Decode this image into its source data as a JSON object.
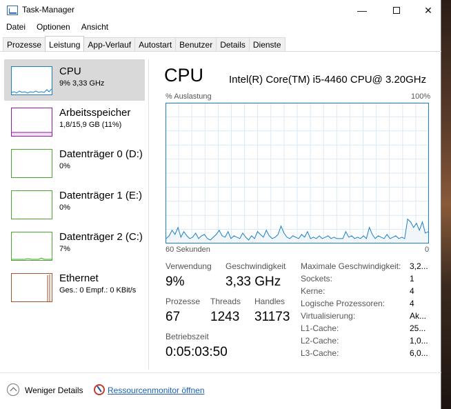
{
  "window": {
    "title": "Task-Manager"
  },
  "menu": [
    "Datei",
    "Optionen",
    "Ansicht"
  ],
  "tabs": [
    "Prozesse",
    "Leistung",
    "App-Verlauf",
    "Autostart",
    "Benutzer",
    "Details",
    "Dienste"
  ],
  "active_tab": "Leistung",
  "sidebar": {
    "items": [
      {
        "name": "CPU",
        "sub": "9%  3,33 GHz",
        "color": "#1a7ec4",
        "selected": true
      },
      {
        "name": "Arbeitsspeicher",
        "sub": "1,8/15,9 GB (11%)",
        "color": "#8b1a9e",
        "selected": false
      },
      {
        "name": "Datenträger 0 (D:)",
        "sub": "0%",
        "color": "#4aa52e",
        "selected": false
      },
      {
        "name": "Datenträger 1 (E:)",
        "sub": "0%",
        "color": "#4aa52e",
        "selected": false
      },
      {
        "name": "Datenträger 2 (C:)",
        "sub": "7%",
        "color": "#4aa52e",
        "selected": false
      },
      {
        "name": "Ethernet",
        "sub": "Ges.: 0 Empf.: 0 KBit/s",
        "color": "#a0522d",
        "selected": false
      }
    ]
  },
  "main": {
    "title": "CPU",
    "model": "Intel(R) Core(TM) i5-4460 CPU@ 3.20GHz",
    "graph": {
      "label_left": "% Auslastung",
      "label_right": "100%",
      "axis_left": "60 Sekunden",
      "axis_right": "0",
      "color": "#1a7ec4",
      "values": [
        3,
        5,
        9,
        6,
        11,
        4,
        8,
        5,
        3,
        4,
        7,
        3,
        5,
        6,
        3,
        2,
        4,
        6,
        9,
        5,
        4,
        8,
        3,
        5,
        4,
        3,
        7,
        4,
        2,
        5,
        3,
        8,
        6,
        4,
        9,
        5,
        3,
        4,
        6,
        12,
        7,
        4,
        3,
        5,
        4,
        3,
        6,
        4,
        8,
        3,
        4,
        3,
        5,
        3,
        4,
        5,
        3,
        4,
        3,
        3,
        3,
        8,
        4,
        5,
        3,
        4,
        3,
        5,
        3,
        11,
        6,
        3,
        5,
        4,
        3,
        6,
        3,
        4,
        5,
        3,
        4,
        3,
        17,
        15,
        11,
        14,
        9,
        15,
        7,
        8
      ]
    },
    "stats": {
      "utilization_label": "Verwendung",
      "utilization": "9%",
      "speed_label": "Geschwindigkeit",
      "speed": "3,33 GHz",
      "processes_label": "Prozesse",
      "processes": "67",
      "threads_label": "Threads",
      "threads": "1243",
      "handles_label": "Handles",
      "handles": "31173",
      "uptime_label": "Betriebszeit",
      "uptime": "0:05:03:50"
    },
    "details": [
      {
        "label": "Maximale Geschwindigkeit:",
        "value": "3,2..."
      },
      {
        "label": "Sockets:",
        "value": "1"
      },
      {
        "label": "Kerne:",
        "value": "4"
      },
      {
        "label": "Logische Prozessoren:",
        "value": "4"
      },
      {
        "label": "Virtualisierung:",
        "value": "Ak..."
      },
      {
        "label": "L1-Cache:",
        "value": "25..."
      },
      {
        "label": "L2-Cache:",
        "value": "1,0..."
      },
      {
        "label": "L3-Cache:",
        "value": "6,0..."
      }
    ]
  },
  "footer": {
    "fewer_details": "Weniger Details",
    "resource_monitor": "Ressourcenmonitor öffnen"
  }
}
